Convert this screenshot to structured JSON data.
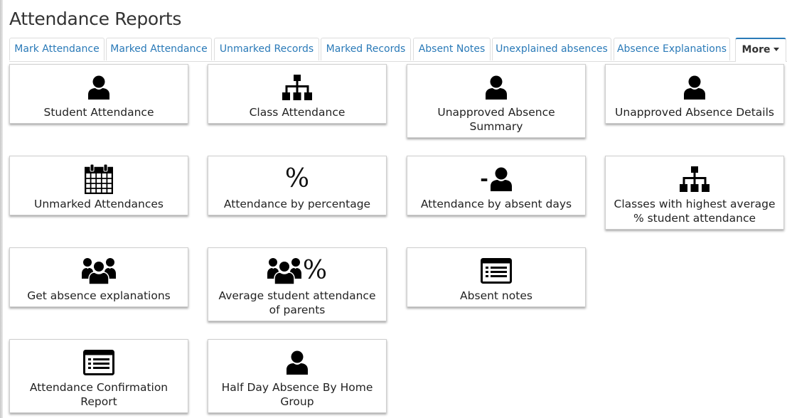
{
  "page": {
    "title": "Attendance Reports"
  },
  "tabs": [
    {
      "label": "Mark Attendance"
    },
    {
      "label": "Marked Attendance"
    },
    {
      "label": "Unmarked Records"
    },
    {
      "label": "Marked Records"
    },
    {
      "label": "Absent Notes"
    },
    {
      "label": "Unexplained absences"
    },
    {
      "label": "Absence Explanations"
    },
    {
      "label": "More",
      "active": true,
      "icon": "caret-down-icon"
    }
  ],
  "cards": [
    {
      "label": "Student Attendance",
      "icon": "user-icon"
    },
    {
      "label": "Class Attendance",
      "icon": "sitemap-icon"
    },
    {
      "label": "Unapproved Absence Summary",
      "icon": "user-icon"
    },
    {
      "label": "Unapproved Absence Details",
      "icon": "user-icon"
    },
    {
      "label": "Unmarked Attendances",
      "icon": "calendar-icon"
    },
    {
      "label": "Attendance by percentage",
      "icon": "percent-icon",
      "icon_text": "%"
    },
    {
      "label": "Attendance by absent days",
      "icon": "minus-user-icon",
      "icon_text": "-"
    },
    {
      "label": "Classes with highest average % student attendance",
      "icon": "sitemap-icon"
    },
    {
      "label": "Get absence explanations",
      "icon": "users-icon"
    },
    {
      "label": "Average student attendance of parents",
      "icon": "users-percent-icon",
      "icon_text": "%"
    },
    {
      "label": "Absent notes",
      "icon": "list-alt-icon"
    },
    {
      "label": "Attendance Confirmation Report",
      "icon": "list-alt-icon"
    },
    {
      "label": "Half Day Absence By Home Group",
      "icon": "user-icon"
    }
  ],
  "colors": {
    "link": "#2a7ab8",
    "active_tab_border": "#2a7ab8",
    "icon": "#000000"
  }
}
